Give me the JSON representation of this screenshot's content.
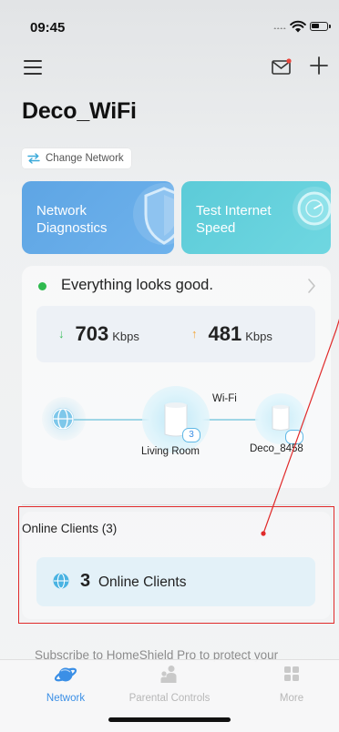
{
  "status_bar": {
    "time": "09:45"
  },
  "header": {
    "title": "Deco_WiFi"
  },
  "change_network": {
    "label": "Change Network"
  },
  "actions": {
    "diagnostics": {
      "line1": "Network",
      "line2": "Diagnostics"
    },
    "speed_test": {
      "line1": "Test Internet",
      "line2": "Speed"
    }
  },
  "network_status": {
    "message": "Everything looks good.",
    "download": {
      "value": "703",
      "unit": "Kbps"
    },
    "upload": {
      "value": "481",
      "unit": "Kbps"
    },
    "link_label": "Wi-Fi",
    "nodes": [
      {
        "name": "Living Room",
        "badge": "3"
      },
      {
        "name": "Deco_8458",
        "badge": ""
      }
    ]
  },
  "clients": {
    "title": "Online Clients (3)",
    "count": "3",
    "label": "Online Clients"
  },
  "promo": {
    "text": "Subscribe to HomeShield Pro to protect your"
  },
  "tabs": [
    {
      "label": "Network",
      "active": true
    },
    {
      "label": "Parental Controls",
      "active": false
    },
    {
      "label": "More",
      "active": false
    }
  ],
  "colors": {
    "accent": "#3b8fe6",
    "status_good": "#2fba4f",
    "annotation": "#e02a2a"
  },
  "icons": [
    "menu-icon",
    "mail-icon",
    "plus-icon",
    "swap-icon",
    "shield-icon",
    "speedometer-icon",
    "chevron-right-icon",
    "globe-icon",
    "planet-icon",
    "people-icon",
    "grid-icon"
  ]
}
